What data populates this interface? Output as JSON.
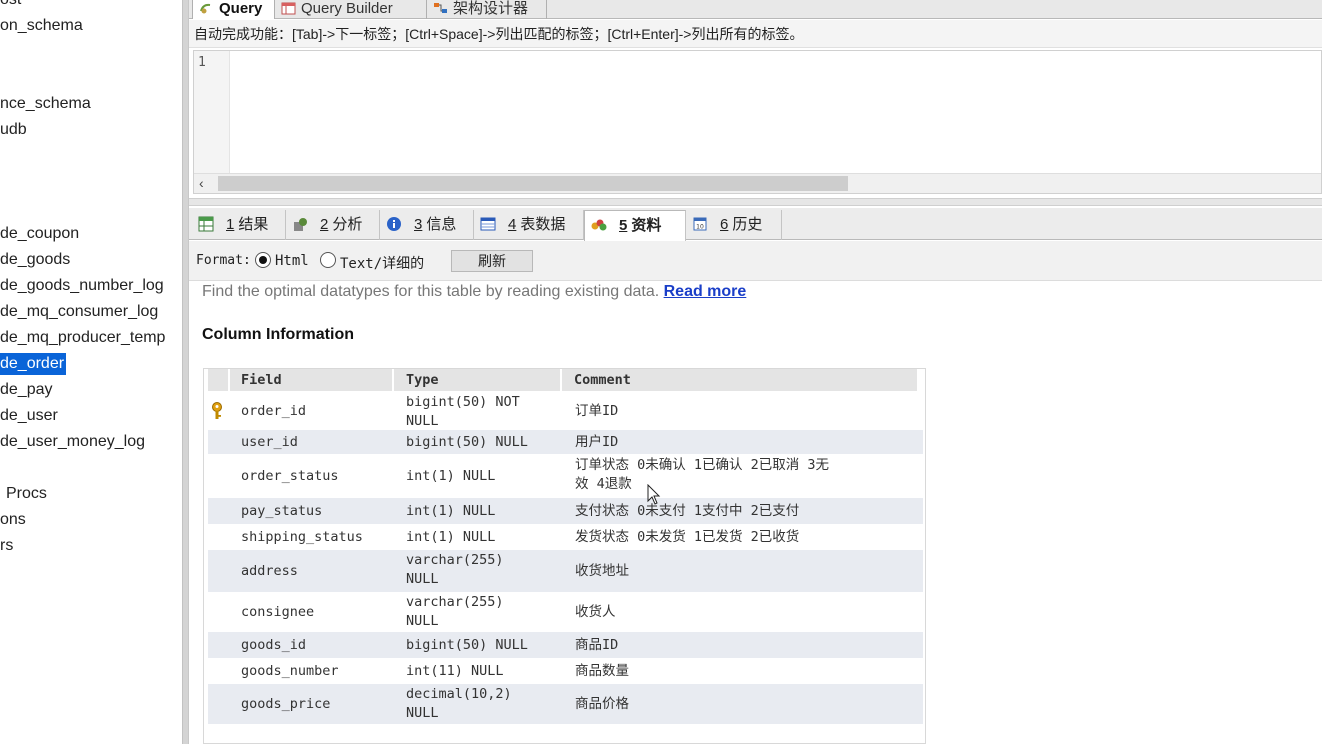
{
  "sidebar": {
    "items": [
      {
        "label": "ost",
        "selected": false
      },
      {
        "label": "on_schema",
        "selected": false
      },
      {
        "label": "nce_schema",
        "selected": false
      },
      {
        "label": "udb",
        "selected": false
      },
      {
        "label": "de_coupon",
        "selected": false
      },
      {
        "label": "de_goods",
        "selected": false
      },
      {
        "label": "de_goods_number_log",
        "selected": false
      },
      {
        "label": "de_mq_consumer_log",
        "selected": false
      },
      {
        "label": "de_mq_producer_temp",
        "selected": false
      },
      {
        "label": "de_order",
        "selected": true
      },
      {
        "label": "de_pay",
        "selected": false
      },
      {
        "label": "de_user",
        "selected": false
      },
      {
        "label": "de_user_money_log",
        "selected": false
      },
      {
        "label": "Procs",
        "selected": false
      },
      {
        "label": "ons",
        "selected": false
      },
      {
        "label": "rs",
        "selected": false
      }
    ]
  },
  "query_tabs": [
    {
      "label": "Query",
      "icon": "query-icon",
      "active": true
    },
    {
      "label": "Query Builder",
      "icon": "query-builder-icon",
      "active": false
    },
    {
      "label": "架构设计器",
      "icon": "schema-designer-icon",
      "active": false
    }
  ],
  "hint": "自动完成功能：[Tab]->下一标签；[Ctrl+Space]->列出匹配的标签；[Ctrl+Enter]->列出所有的标签。",
  "editor": {
    "line_number": "1"
  },
  "result_tabs": [
    {
      "num": "1",
      "label": "结果",
      "icon": "results-grid-icon",
      "active": false
    },
    {
      "num": "2",
      "label": "分析",
      "icon": "profiler-icon",
      "active": false
    },
    {
      "num": "3",
      "label": "信息",
      "icon": "info-icon",
      "active": false
    },
    {
      "num": "4",
      "label": "表数据",
      "icon": "table-data-icon",
      "active": false
    },
    {
      "num": "5",
      "label": "资料",
      "icon": "table-info-icon",
      "active": true
    },
    {
      "num": "6",
      "label": "历史",
      "icon": "history-icon",
      "active": false
    }
  ],
  "format_bar": {
    "label": "Format:",
    "option_html": "Html",
    "option_text": "Text/详细的",
    "selected": "Html",
    "refresh_label": "刷新"
  },
  "info": {
    "intro_text": "Find the optimal datatypes for this table by reading existing data.",
    "read_more": "Read more",
    "section_title": "Column Information",
    "headers": [
      "Field",
      "Type",
      "Comment"
    ],
    "rows": [
      {
        "key": true,
        "field": "order_id",
        "type_lines": [
          "bigint(50) NOT",
          "NULL"
        ],
        "comment_lines": [
          "订单ID"
        ]
      },
      {
        "key": false,
        "field": "user_id",
        "type_lines": [
          "bigint(50) NULL"
        ],
        "comment_lines": [
          "用户ID"
        ]
      },
      {
        "key": false,
        "field": "order_status",
        "type_lines": [
          "int(1) NULL"
        ],
        "comment_lines": [
          "订单状态 0未确认 1已确认 2已取消 3无",
          "效 4退款"
        ]
      },
      {
        "key": false,
        "field": "pay_status",
        "type_lines": [
          "int(1) NULL"
        ],
        "comment_lines": [
          "支付状态 0未支付 1支付中 2已支付"
        ]
      },
      {
        "key": false,
        "field": "shipping_status",
        "type_lines": [
          "int(1) NULL"
        ],
        "comment_lines": [
          "发货状态 0未发货 1已发货 2已收货"
        ]
      },
      {
        "key": false,
        "field": "address",
        "type_lines": [
          "varchar(255)",
          "NULL"
        ],
        "comment_lines": [
          "收货地址"
        ]
      },
      {
        "key": false,
        "field": "consignee",
        "type_lines": [
          "varchar(255)",
          "NULL"
        ],
        "comment_lines": [
          "收货人"
        ]
      },
      {
        "key": false,
        "field": "goods_id",
        "type_lines": [
          "bigint(50) NULL"
        ],
        "comment_lines": [
          "商品ID"
        ]
      },
      {
        "key": false,
        "field": "goods_number",
        "type_lines": [
          "int(11) NULL"
        ],
        "comment_lines": [
          "商品数量"
        ]
      },
      {
        "key": false,
        "field": "goods_price",
        "type_lines": [
          "decimal(10,2)",
          "NULL"
        ],
        "comment_lines": [
          "商品价格"
        ]
      }
    ]
  },
  "colors": {
    "selection": "#0a64d8",
    "link": "#1a3ec8",
    "row_shade": "#e8ebf1",
    "header_bg": "#e4e4e4"
  }
}
